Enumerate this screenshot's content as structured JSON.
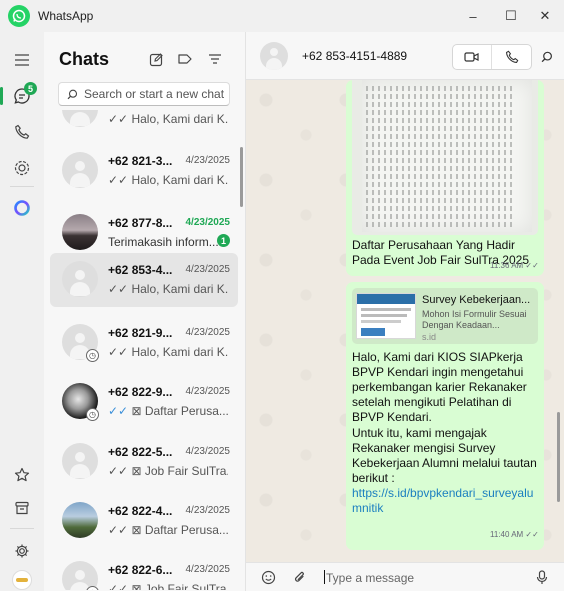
{
  "window": {
    "app_title": "WhatsApp",
    "minimize": "–",
    "maximize": "☐",
    "close": "✕"
  },
  "rail": {
    "chats_badge": "5"
  },
  "panel": {
    "title": "Chats",
    "search_placeholder": "Search or start a new chat"
  },
  "chats": [
    {
      "name": "",
      "date": "",
      "preview": "✓✓ Halo, Kami dari K...",
      "avatar": "default",
      "status": false
    },
    {
      "name": "+62 821-3...",
      "date": "4/23/2025",
      "preview": "✓✓ Halo, Kami dari K...",
      "avatar": "default",
      "status": false
    },
    {
      "name": "+62 877-8...",
      "date": "4/23/2025",
      "preview": "Terimakasih inform...",
      "avatar": "photo1",
      "status": false,
      "unread": "1"
    },
    {
      "name": "+62 853-4...",
      "date": "4/23/2025",
      "preview": "✓✓ Halo, Kami dari K...",
      "avatar": "default",
      "status": false
    },
    {
      "name": "+62 821-9...",
      "date": "4/23/2025",
      "preview": "✓✓ Halo, Kami dari K...",
      "avatar": "default",
      "status": true
    },
    {
      "name": "+62 822-9...",
      "date": "4/23/2025",
      "preview": "✓✓ ⊠ Daftar Perusa...",
      "avatar": "photo2",
      "status": true
    },
    {
      "name": "+62 822-5...",
      "date": "4/23/2025",
      "preview": "✓✓ ⊠ Job Fair SulTra...",
      "avatar": "default",
      "status": false
    },
    {
      "name": "+62 822-4...",
      "date": "4/23/2025",
      "preview": "✓✓ ⊠ Daftar Perusa...",
      "avatar": "photo3",
      "status": false
    },
    {
      "name": "+62 822-6...",
      "date": "4/23/2025",
      "preview": "✓✓ ⊠ Job Fair SulTra...",
      "avatar": "default",
      "status": true
    }
  ],
  "conversation": {
    "contact_name": "+62 853-4151-4889",
    "image_caption": "Daftar Perusahaan Yang Hadir Pada Event Job Fair SulTra 2025",
    "image_time": "11:36 AM ✓✓",
    "link_title": "Survey Kebekerjaan...",
    "link_desc": "Mohon Isi Formulir Sesuai Dengan Keadaan...",
    "link_domain": "s.id",
    "msg_p1": "Halo, Kami dari KIOS SIAPkerja BPVP Kendari ingin mengetahui perkembangan karier Rekanaker setelah mengikuti Pelatihan di BPVP Kendari.",
    "msg_p2": "Untuk itu, kami mengajak Rekanaker mengisi Survey Kebekerjaan Alumni melalui tautan berikut :",
    "msg_link": "https://s.id/bpvpkendari_surveyalumnitik",
    "msg_time": "11:40 AM ✓✓",
    "composer_placeholder": "Type a message"
  },
  "colors": {
    "accent_green": "#1fa855",
    "bubble_green": "#d9fdd3",
    "chat_background": "#efeae2",
    "link_blue": "#1b7fc0",
    "read_tick_blue": "#3a8fd9"
  },
  "icons": {
    "app": "whatsapp-logo-icon",
    "menu": "hamburger-menu-icon",
    "chats": "chat-bubble-icon",
    "calls": "phone-icon",
    "status": "status-circle-icon",
    "meta_ai": "meta-ai-ring-icon",
    "starred": "star-icon",
    "archived": "archive-box-icon",
    "settings": "gear-icon",
    "profile": "profile-avatar-icon",
    "new_chat": "new-chat-pencil-icon",
    "filter": "filter-tag-icon",
    "chat_filter": "filter-lines-icon",
    "search": "search-icon",
    "video_call": "video-camera-icon",
    "voice_call": "phone-icon",
    "emoji": "emoji-smiley-icon",
    "attach": "paperclip-icon",
    "mic": "microphone-icon"
  }
}
